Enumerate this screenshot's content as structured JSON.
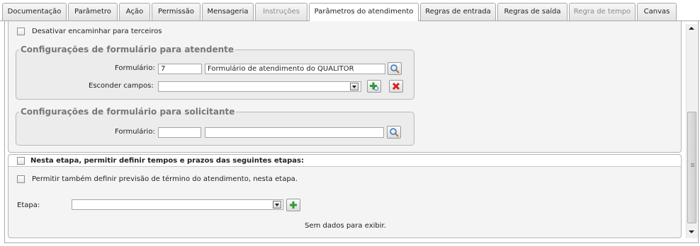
{
  "tabs": [
    {
      "label": "Documentação",
      "state": "normal"
    },
    {
      "label": "Parâmetro",
      "state": "normal"
    },
    {
      "label": "Ação",
      "state": "normal"
    },
    {
      "label": "Permissão",
      "state": "normal"
    },
    {
      "label": "Mensageria",
      "state": "normal"
    },
    {
      "label": "Instruções",
      "state": "disabled"
    },
    {
      "label": "Parâmetros do atendimento",
      "state": "active"
    },
    {
      "label": "Regras de entrada",
      "state": "normal"
    },
    {
      "label": "Regras de saída",
      "state": "normal"
    },
    {
      "label": "Regra de tempo",
      "state": "disabled"
    },
    {
      "label": "Canvas",
      "state": "normal"
    }
  ],
  "forward_checkbox": {
    "label": "Desativar encaminhar para terceiros",
    "checked": false
  },
  "attendant_form": {
    "legend": "Configurações de formulário para atendente",
    "form_label": "Formulário:",
    "form_code": "7",
    "form_name": "Formulário de atendimento do QUALITOR",
    "hide_fields_label": "Esconder campos:",
    "hide_fields_value": ""
  },
  "requester_form": {
    "legend": "Configurações de formulário para solicitante",
    "form_label": "Formulário:",
    "form_code": "",
    "form_name": ""
  },
  "deadlines": {
    "header_label": "Nesta etapa, permitir definir tempos e prazos das seguintes etapas:",
    "header_checked": false,
    "forecast_label": "Permitir também definir previsão de término do atendimento, nesta etapa.",
    "forecast_checked": false,
    "stage_label": "Etapa:",
    "stage_value": "",
    "empty_text": "Sem dados para exibir."
  },
  "icons": {
    "search": "magnifier-icon",
    "add": "add-green-icon",
    "remove": "remove-red-icon"
  }
}
